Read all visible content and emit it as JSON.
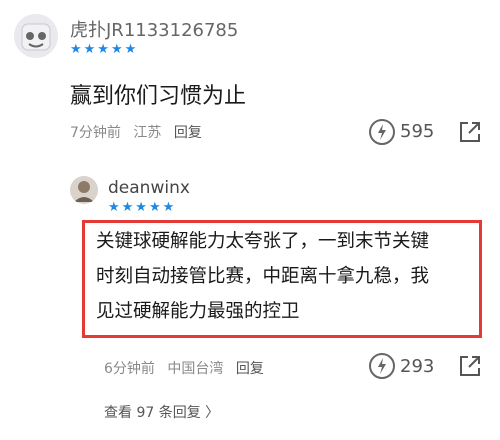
{
  "comments": [
    {
      "username": "虎扑JR1133126785",
      "stars": "★★★★★",
      "content": "赢到你们习惯为止",
      "time": "7分钟前",
      "location": "江苏",
      "reply_label": "回复",
      "likes": "595"
    },
    {
      "username": "deanwinx",
      "stars": "★★★★★",
      "content_lines": [
        "关键球硬解能力太夸张了，一到末节关键",
        "时刻自动接管比赛，中距离十拿九稳，我",
        "见过硬解能力最强的控卫"
      ],
      "time": "6分钟前",
      "location": "中国台湾",
      "reply_label": "回复",
      "likes": "293"
    }
  ],
  "view_more": "查看 97 条回复 〉",
  "colors": {
    "star": "#1e88e5",
    "highlight_border": "#e53935"
  },
  "icons": [
    "like-icon",
    "share-icon"
  ]
}
